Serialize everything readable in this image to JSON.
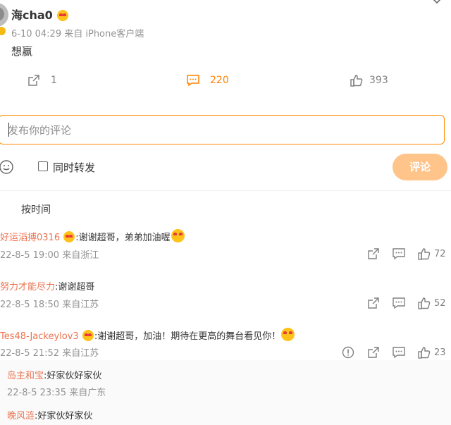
{
  "post": {
    "username": "海cha0",
    "meta": "6-10 04:29  来自 iPhone客户端",
    "text": "想赢"
  },
  "actions": {
    "forward_count": "1",
    "comment_count": "220",
    "like_count": "393"
  },
  "composer": {
    "placeholder": "发布你的评论",
    "forward_label": "同时转发",
    "submit_label": "评论"
  },
  "sort_label": "按时间",
  "comments": [
    {
      "name": "好运滔搏0316",
      "text": ":谢谢超哥，弟弟加油喔",
      "time": "22-8-5 19:00 来自浙江",
      "likes": "72"
    },
    {
      "name": "努力才能尽力",
      "text": ":谢谢超哥",
      "time": "22-8-5 18:50 来自江苏",
      "likes": "52"
    },
    {
      "name": "Tes48-Jackeylov3",
      "text": ":谢谢超哥，加油！期待在更高的舞台看见你！",
      "time": "22-8-5 21:52 来自江苏",
      "likes": "23"
    }
  ],
  "replies": [
    {
      "name": "岛主和宝",
      "text": ":好家伙好家伙",
      "time": "22-8-5 23:35 来自广东"
    },
    {
      "name": "晚风涟",
      "text": ":好家伙好家伙"
    }
  ],
  "colors": {
    "accent": "#ff8200",
    "link": "#eb7350",
    "submit_bg": "#ffc48a",
    "border": "#ff8a00"
  }
}
